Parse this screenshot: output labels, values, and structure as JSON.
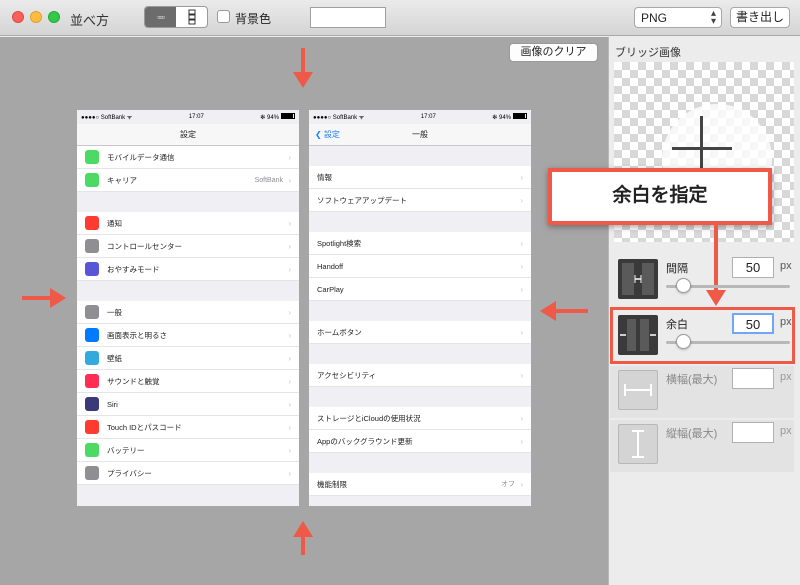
{
  "window": {
    "title": "並べ方"
  },
  "toolbar": {
    "layout_segments": [
      "▫▫▫",
      "⋮"
    ],
    "background_label": "背景色",
    "format_value": "PNG",
    "export_label": "書き出し"
  },
  "canvas": {
    "clear_label": "画像のクリア"
  },
  "phone1": {
    "status": {
      "carrier": "●●●●○ SoftBank ᯤ",
      "time": "17:07",
      "right": "✻ 94%"
    },
    "nav_title": "設定",
    "group1": [
      {
        "label": "モバイルデータ通信",
        "icon_color": "#4cd964"
      },
      {
        "label": "キャリア",
        "value": "SoftBank",
        "icon_color": "#4cd964"
      }
    ],
    "group2": [
      {
        "label": "通知",
        "icon_color": "#ff3b30"
      },
      {
        "label": "コントロールセンター",
        "icon_color": "#8e8e93"
      },
      {
        "label": "おやすみモード",
        "icon_color": "#5856d6"
      }
    ],
    "group3": [
      {
        "label": "一般",
        "icon_color": "#8e8e93"
      },
      {
        "label": "画面表示と明るさ",
        "icon_color": "#007aff"
      },
      {
        "label": "壁紙",
        "icon_color": "#34aadc"
      },
      {
        "label": "サウンドと触覚",
        "icon_color": "#ff2d55"
      },
      {
        "label": "Siri",
        "icon_color": "#3a3a7a"
      },
      {
        "label": "Touch IDとパスコード",
        "icon_color": "#ff3b30"
      },
      {
        "label": "バッテリー",
        "icon_color": "#4cd964"
      },
      {
        "label": "プライバシー",
        "icon_color": "#8e8e93"
      }
    ]
  },
  "phone2": {
    "status": {
      "carrier": "●●●●○ SoftBank ᯤ",
      "time": "17:07",
      "right": "✻ 94%"
    },
    "back_label": "設定",
    "nav_title": "一般",
    "group1": [
      {
        "label": "情報"
      },
      {
        "label": "ソフトウェアアップデート"
      }
    ],
    "group2": [
      {
        "label": "Spotlight検索"
      },
      {
        "label": "Handoff"
      },
      {
        "label": "CarPlay"
      }
    ],
    "group3": [
      {
        "label": "ホームボタン"
      }
    ],
    "group4": [
      {
        "label": "アクセシビリティ"
      }
    ],
    "group5": [
      {
        "label": "ストレージとiCloudの使用状況"
      },
      {
        "label": "Appのバックグラウンド更新"
      }
    ],
    "group6": [
      {
        "label": "機能制限",
        "value": "オフ"
      }
    ]
  },
  "panel": {
    "title": "ブリッジ画像",
    "callout": "余白を指定",
    "spacing": {
      "label": "間隔",
      "value": "50",
      "unit": "px",
      "slider_fraction": 0.1
    },
    "margin": {
      "label": "余白",
      "value": "50",
      "unit": "px",
      "slider_fraction": 0.1
    },
    "max_width": {
      "label": "横幅(最大)",
      "value": "",
      "unit": "px"
    },
    "max_height": {
      "label": "縦幅(最大)",
      "value": "",
      "unit": "px"
    }
  },
  "colors": {
    "accent_arrow": "#ef5a48",
    "focus": "#6fa6f5",
    "ios_link": "#1a7df5"
  }
}
